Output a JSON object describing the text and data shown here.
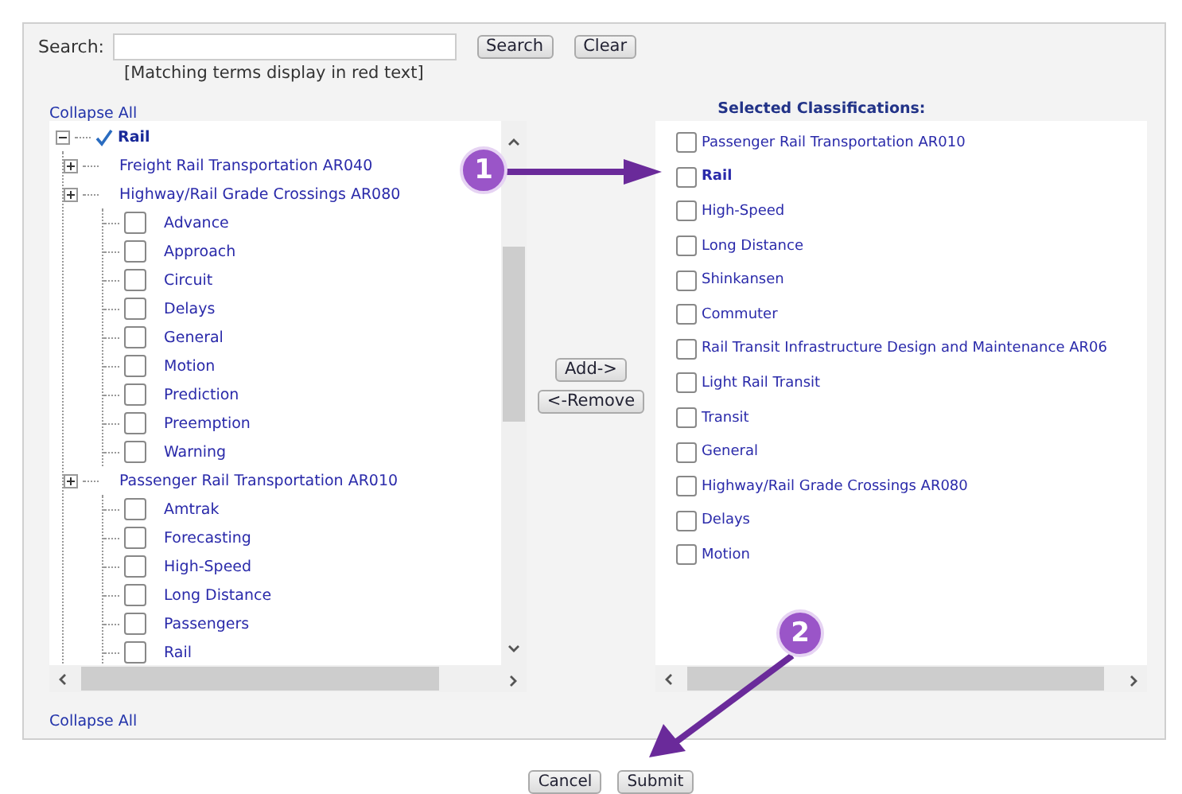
{
  "search": {
    "label": "Search:",
    "buttons": [
      "Search",
      "Clear"
    ],
    "hint": "[Matching terms display in red text]"
  },
  "collapse_links": [
    "Collapse All",
    "Collapse All"
  ],
  "tree": [
    {
      "label": "Rail",
      "checked": true,
      "expanded": true,
      "emphasis": true,
      "children": [
        {
          "label": "Freight Rail Transportation AR040",
          "expanded": false
        },
        {
          "label": "Highway/Rail Grade Crossings AR080",
          "expanded": false,
          "children": [
            {
              "label": "Advance",
              "checked": false
            },
            {
              "label": "Approach",
              "checked": false
            },
            {
              "label": "Circuit",
              "checked": false
            },
            {
              "label": "Delays",
              "checked": false
            },
            {
              "label": "General",
              "checked": false
            },
            {
              "label": "Motion",
              "checked": false
            },
            {
              "label": "Prediction",
              "checked": false
            },
            {
              "label": "Preemption",
              "checked": false
            },
            {
              "label": "Warning",
              "checked": false
            }
          ]
        },
        {
          "label": "Passenger Rail Transportation AR010",
          "expanded": false,
          "children": [
            {
              "label": "Amtrak",
              "checked": false
            },
            {
              "label": "Forecasting",
              "checked": false
            },
            {
              "label": "High-Speed",
              "checked": false
            },
            {
              "label": "Long Distance",
              "checked": false
            },
            {
              "label": "Passengers",
              "checked": false
            },
            {
              "label": "Rail",
              "checked": false
            }
          ]
        }
      ]
    }
  ],
  "transfer_buttons": [
    "Add->",
    "<-Remove"
  ],
  "selected": {
    "title": "Selected Classifications:",
    "items": [
      {
        "label": "Passenger Rail Transportation AR010",
        "checked": false,
        "emphasis": false
      },
      {
        "label": "Rail",
        "checked": false,
        "emphasis": true
      },
      {
        "label": "High-Speed",
        "checked": false,
        "emphasis": false
      },
      {
        "label": "Long Distance",
        "checked": false,
        "emphasis": false
      },
      {
        "label": "Shinkansen",
        "checked": false,
        "emphasis": false
      },
      {
        "label": "Commuter",
        "checked": false,
        "emphasis": false
      },
      {
        "label": "Rail Transit Infrastructure Design and Maintenance AR06",
        "checked": false,
        "emphasis": false
      },
      {
        "label": "Light Rail Transit",
        "checked": false,
        "emphasis": false
      },
      {
        "label": "Transit",
        "checked": false,
        "emphasis": false
      },
      {
        "label": "General",
        "checked": false,
        "emphasis": false
      },
      {
        "label": "Highway/Rail Grade Crossings AR080",
        "checked": false,
        "emphasis": false
      },
      {
        "label": "Delays",
        "checked": false,
        "emphasis": false
      },
      {
        "label": "Motion",
        "checked": false,
        "emphasis": false
      }
    ]
  },
  "callouts": [
    "1",
    "2"
  ],
  "footer_buttons": [
    "Cancel",
    "Submit"
  ]
}
